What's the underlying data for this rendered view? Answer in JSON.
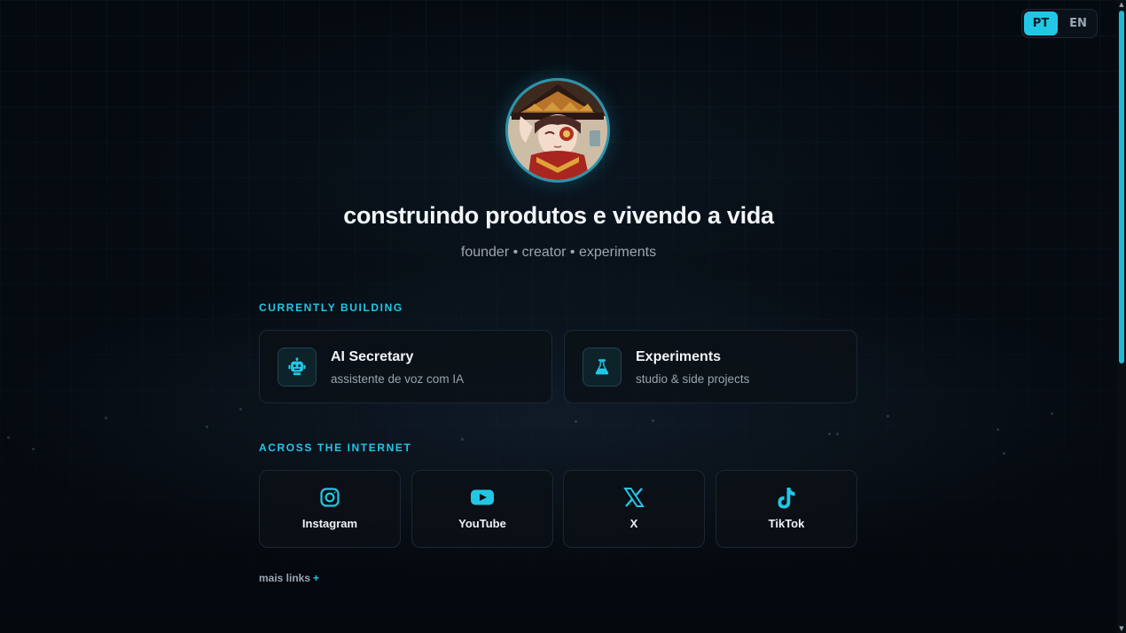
{
  "language_switcher": {
    "options": [
      "PT",
      "EN"
    ],
    "selected": "PT"
  },
  "profile": {
    "headline": "construindo produtos e vivendo a vida",
    "tagline": "founder • creator • experiments"
  },
  "currently_building": {
    "label": "CURRENTLY BUILDING",
    "items": [
      {
        "title": "AI Secretary",
        "subtitle": "assistente de voz com IA",
        "icon": "robot-icon"
      },
      {
        "title": "Experiments",
        "subtitle": "studio & side projects",
        "icon": "flask-icon"
      }
    ]
  },
  "across_internet": {
    "label": "ACROSS THE INTERNET",
    "links": [
      {
        "label": "Instagram",
        "icon": "instagram-icon"
      },
      {
        "label": "YouTube",
        "icon": "youtube-icon"
      },
      {
        "label": "X",
        "icon": "x-icon"
      },
      {
        "label": "TikTok",
        "icon": "tiktok-icon"
      }
    ]
  },
  "more_links": {
    "label": "mais links",
    "plus": "+"
  },
  "colors": {
    "accent": "#22c7e6",
    "background": "#05080d",
    "card_border": "#1b2733"
  }
}
